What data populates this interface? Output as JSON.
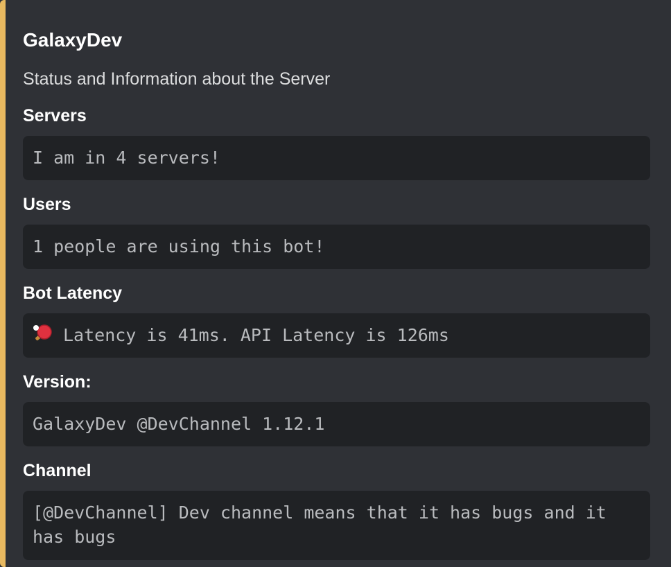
{
  "embed": {
    "accent_color": "#e8b960",
    "title": "GalaxyDev",
    "description": "Status and Information about the Server",
    "fields": [
      {
        "name": "Servers",
        "value": "I am in 4 servers!"
      },
      {
        "name": "Users",
        "value": "1 people are using this bot!"
      },
      {
        "name": "Bot Latency",
        "icon": "ping-pong-icon",
        "value": "Latency is 41ms. API Latency is 126ms"
      },
      {
        "name": "Version:",
        "value": "GalaxyDev @DevChannel 1.12.1"
      },
      {
        "name": "Channel",
        "value": "[@DevChannel] Dev channel means that it has bugs and it has bugs"
      }
    ]
  }
}
